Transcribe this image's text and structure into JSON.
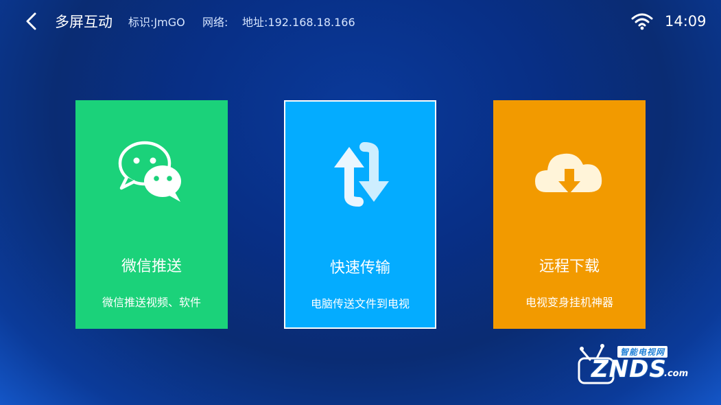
{
  "header": {
    "title": "多屏互动",
    "identity": "标识:JmGO",
    "network": "网络:",
    "address": "地址:192.168.18.166",
    "time": "14:09",
    "icons": {
      "back": "chevron-left-icon",
      "wifi": "wifi-icon"
    }
  },
  "cards": [
    {
      "title": "微信推送",
      "desc": "微信推送视频、软件",
      "color": "#1bd27a",
      "icon": "wechat-icon"
    },
    {
      "title": "快速传输",
      "desc": "电脑传送文件到电视",
      "color": "#04acff",
      "icon": "transfer-arrows-icon",
      "focused": true
    },
    {
      "title": "远程下载",
      "desc": "电视变身挂机神器",
      "color": "#f29a00",
      "icon": "cloud-download-icon"
    }
  ],
  "watermark": {
    "sub": "智能电视网",
    "main": "ZNDS",
    "suffix": ".com"
  }
}
